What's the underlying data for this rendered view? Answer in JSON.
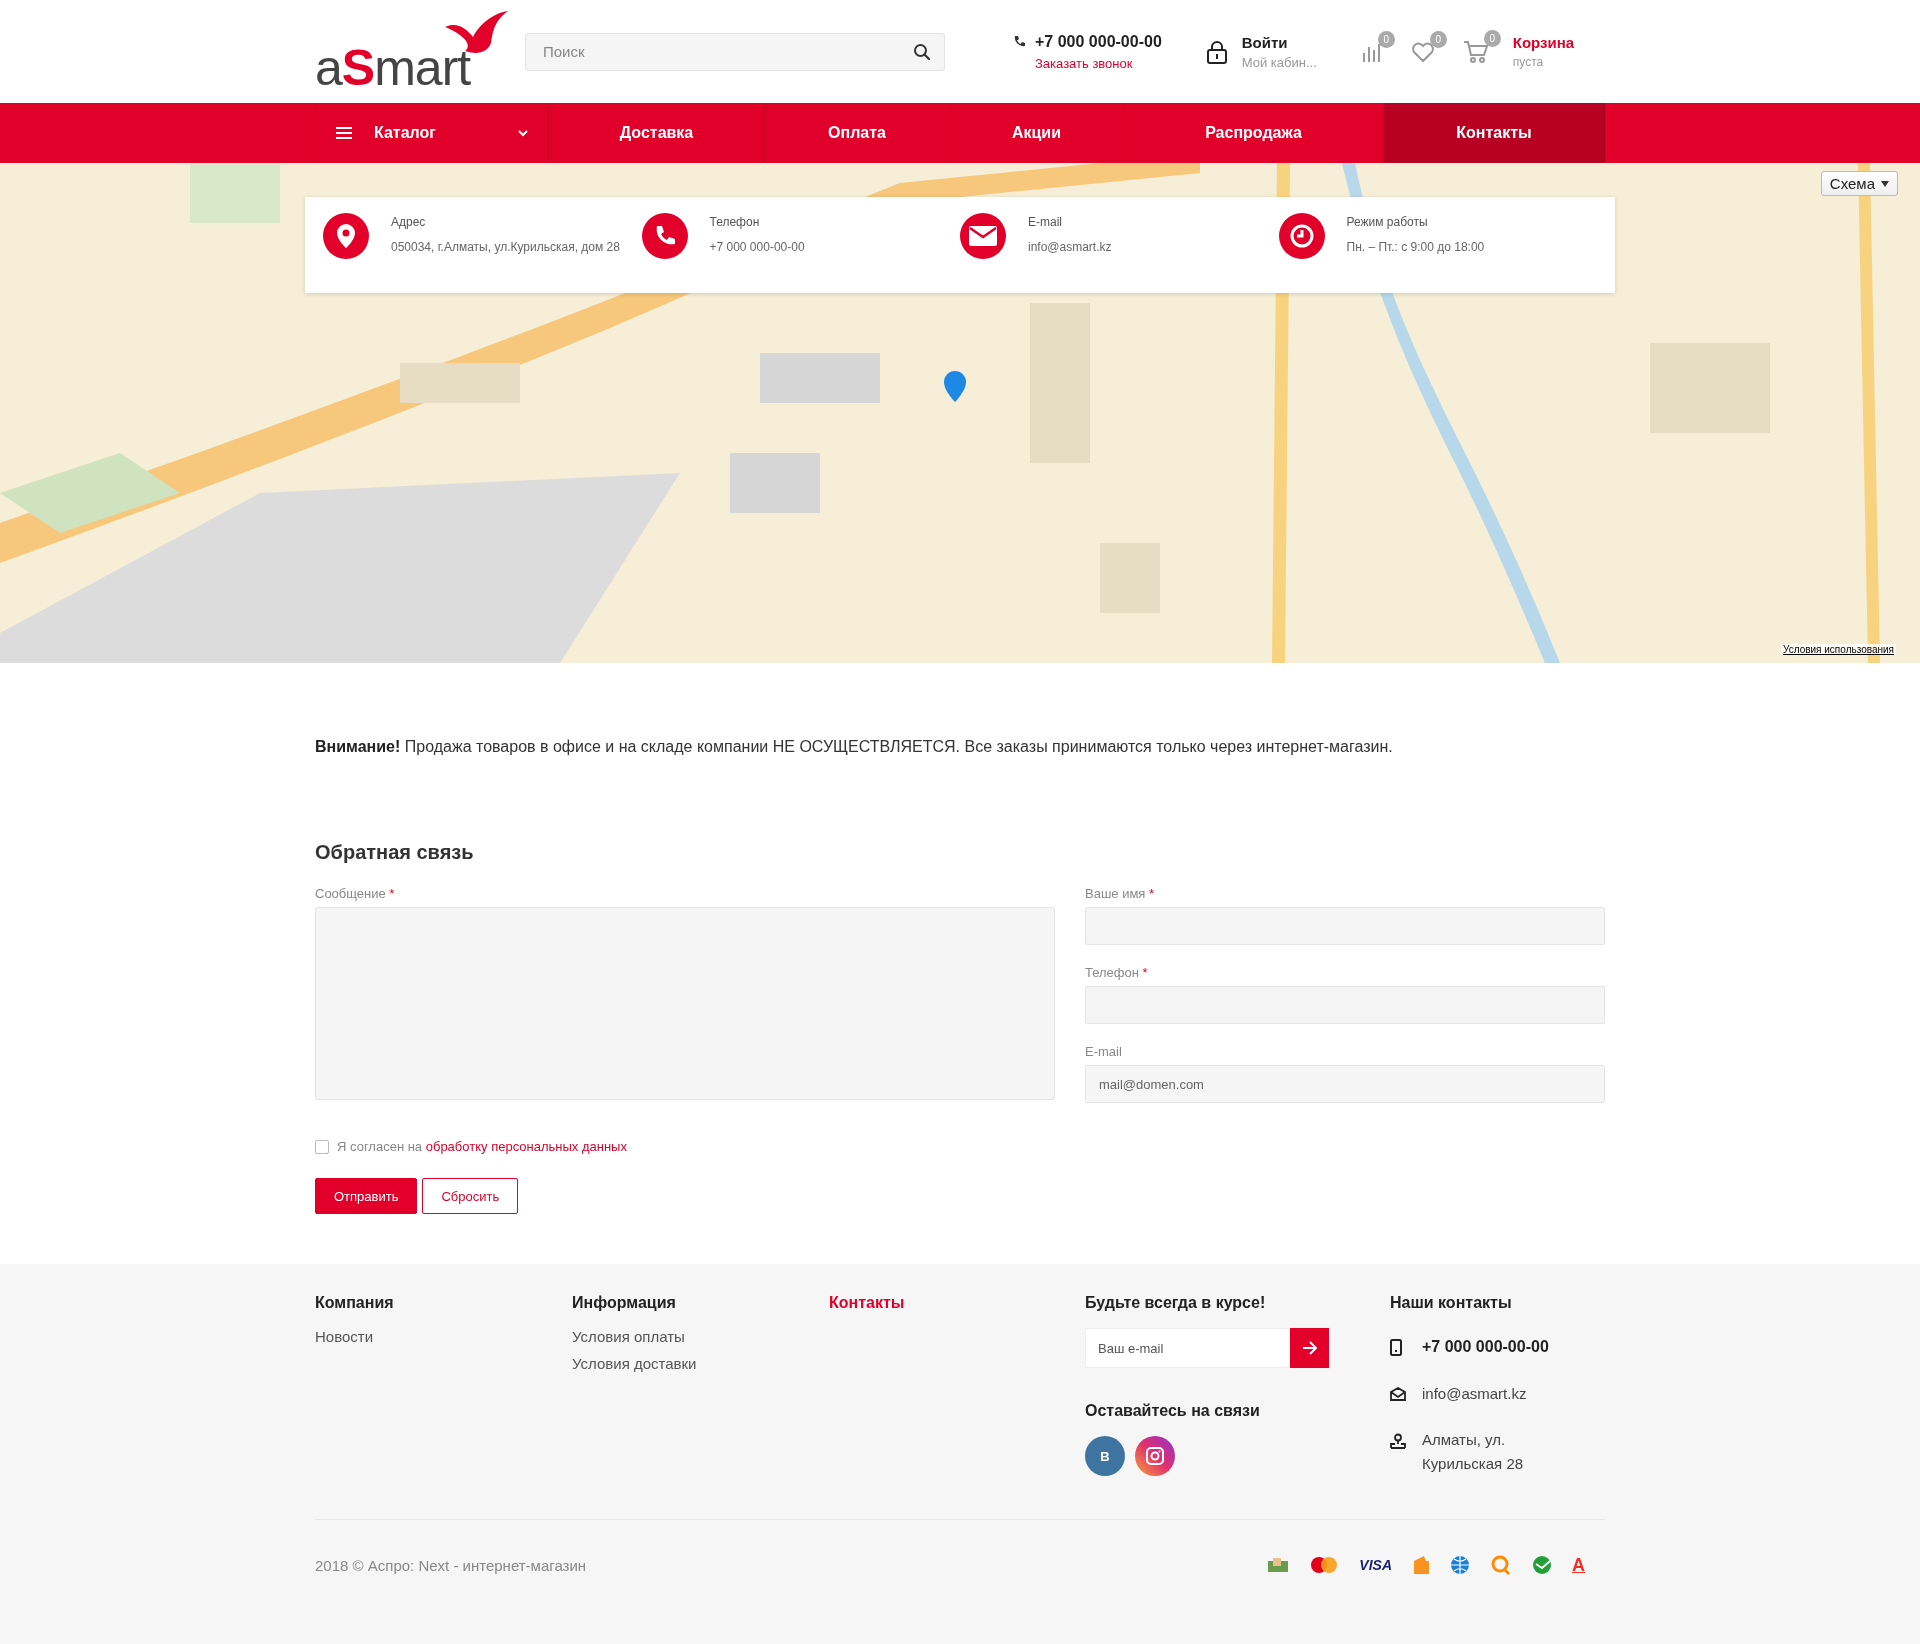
{
  "header": {
    "logo": [
      {
        "text": "a",
        "accent": false
      },
      {
        "text": "S",
        "accent": true
      },
      {
        "text": "mart",
        "accent": false
      }
    ],
    "search": {
      "placeholder": "Поиск"
    },
    "phone": "+7 000 000-00-00",
    "callback_link": "Заказать звонок",
    "login": {
      "label": "Войти",
      "sub": "Мой кабин..."
    },
    "counters": [
      {
        "kind": "compare",
        "count": "0"
      },
      {
        "kind": "wishlist",
        "count": "0"
      },
      {
        "kind": "cart",
        "count": "0"
      }
    ],
    "cart": {
      "label": "Корзина",
      "status": "пуста"
    }
  },
  "nav": [
    {
      "label": "Каталог",
      "kind": "catalog",
      "selected": false
    },
    {
      "label": "Доставка",
      "kind": "link",
      "selected": false
    },
    {
      "label": "Оплата",
      "kind": "link",
      "selected": false
    },
    {
      "label": "Акции",
      "kind": "link",
      "selected": false
    },
    {
      "label": "Распродажа",
      "kind": "link",
      "selected": false
    },
    {
      "label": "Контакты",
      "kind": "link",
      "selected": true
    }
  ],
  "map": {
    "kind": "picture",
    "layer_button": "Схема",
    "terms_link": "Условия использования"
  },
  "contact_strip": [
    {
      "kind": "address",
      "title": "Адрес",
      "text": "050034, г.Алматы, ул.Курильская, дом 28"
    },
    {
      "kind": "phone",
      "title": "Телефон",
      "text": "+7 000 000-00-00"
    },
    {
      "kind": "email",
      "title": "E-mail",
      "text": "info@asmart.kz"
    },
    {
      "kind": "hours",
      "title": "Режим работы",
      "text": "Пн. – Пт.: с 9:00 до 18:00"
    }
  ],
  "notice": "**Внимание!** Продажа товаров в офисе и на складе компании НЕ ОСУЩЕСТВЛЯЕТСЯ. Все заказы принимаются только через интернет-магазин.",
  "feedback": {
    "title": "Обратная связь",
    "fields": [
      {
        "kind": "textarea",
        "label": "Сообщение",
        "mark": "*"
      },
      {
        "kind": "text",
        "label": "Ваше имя",
        "mark": "*"
      },
      {
        "kind": "text",
        "label": "Телефон",
        "mark": "*"
      },
      {
        "kind": "text",
        "label": "E-mail",
        "placeholder": "mail@domen.com"
      }
    ],
    "consent": {
      "text": "Я согласен на",
      "link": "обработку персональных данных",
      "checked": false
    },
    "buttons": [
      {
        "kind": "primary",
        "label": "Отправить"
      },
      {
        "kind": "secondary",
        "label": "Сбросить"
      }
    ]
  },
  "footer": {
    "columns": [
      {
        "title": "Компания",
        "accent": false,
        "links": [
          "Новости"
        ]
      },
      {
        "title": "Информация",
        "accent": false,
        "links": [
          "Условия оплаты",
          "Условия доставки"
        ]
      },
      {
        "title": "Контакты",
        "accent": true
      }
    ],
    "subscribe": {
      "title": "Будьте всегда в курсе!",
      "placeholder": "Ваш e-mail"
    },
    "social": {
      "title": "Оставайтесь на связи",
      "networks": [
        {
          "kind": "vk",
          "label": "В"
        },
        {
          "kind": "instagram"
        }
      ]
    },
    "contacts": {
      "title": "Наши контакты",
      "items": [
        {
          "kind": "phone",
          "text": "+7 000 000-00-00"
        },
        {
          "kind": "email",
          "text": "info@asmart.kz"
        },
        {
          "kind": "address",
          "text": "Алматы, ул. Курильская 28"
        }
      ]
    },
    "copyright": "2018 © Аспро: Next - интернет-магазин",
    "payments": [
      {
        "kind": "cash"
      },
      {
        "kind": "mastercard"
      },
      {
        "kind": "visa",
        "label": "VISA"
      },
      {
        "kind": "wallet"
      },
      {
        "kind": "globe"
      },
      {
        "kind": "qiwi"
      },
      {
        "kind": "sber"
      },
      {
        "kind": "alfa",
        "label": "А"
      }
    ]
  }
}
